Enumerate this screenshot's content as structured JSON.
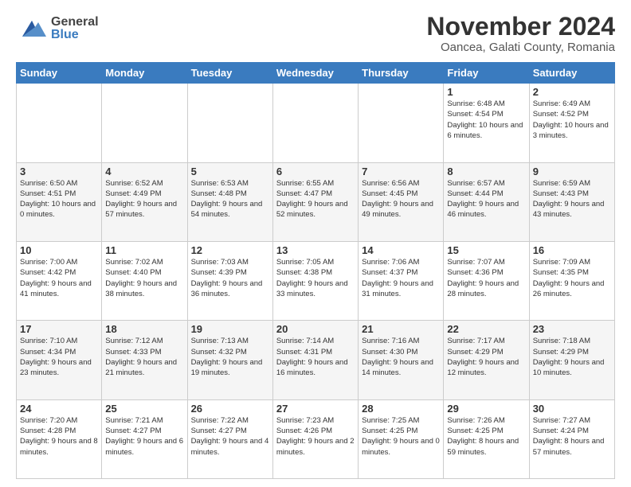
{
  "header": {
    "title": "November 2024",
    "subtitle": "Oancea, Galati County, Romania"
  },
  "logo": {
    "general": "General",
    "blue": "Blue"
  },
  "weekdays": [
    "Sunday",
    "Monday",
    "Tuesday",
    "Wednesday",
    "Thursday",
    "Friday",
    "Saturday"
  ],
  "weeks": [
    [
      {
        "day": "",
        "info": ""
      },
      {
        "day": "",
        "info": ""
      },
      {
        "day": "",
        "info": ""
      },
      {
        "day": "",
        "info": ""
      },
      {
        "day": "",
        "info": ""
      },
      {
        "day": "1",
        "info": "Sunrise: 6:48 AM\nSunset: 4:54 PM\nDaylight: 10 hours and 6 minutes."
      },
      {
        "day": "2",
        "info": "Sunrise: 6:49 AM\nSunset: 4:52 PM\nDaylight: 10 hours and 3 minutes."
      }
    ],
    [
      {
        "day": "3",
        "info": "Sunrise: 6:50 AM\nSunset: 4:51 PM\nDaylight: 10 hours and 0 minutes."
      },
      {
        "day": "4",
        "info": "Sunrise: 6:52 AM\nSunset: 4:49 PM\nDaylight: 9 hours and 57 minutes."
      },
      {
        "day": "5",
        "info": "Sunrise: 6:53 AM\nSunset: 4:48 PM\nDaylight: 9 hours and 54 minutes."
      },
      {
        "day": "6",
        "info": "Sunrise: 6:55 AM\nSunset: 4:47 PM\nDaylight: 9 hours and 52 minutes."
      },
      {
        "day": "7",
        "info": "Sunrise: 6:56 AM\nSunset: 4:45 PM\nDaylight: 9 hours and 49 minutes."
      },
      {
        "day": "8",
        "info": "Sunrise: 6:57 AM\nSunset: 4:44 PM\nDaylight: 9 hours and 46 minutes."
      },
      {
        "day": "9",
        "info": "Sunrise: 6:59 AM\nSunset: 4:43 PM\nDaylight: 9 hours and 43 minutes."
      }
    ],
    [
      {
        "day": "10",
        "info": "Sunrise: 7:00 AM\nSunset: 4:42 PM\nDaylight: 9 hours and 41 minutes."
      },
      {
        "day": "11",
        "info": "Sunrise: 7:02 AM\nSunset: 4:40 PM\nDaylight: 9 hours and 38 minutes."
      },
      {
        "day": "12",
        "info": "Sunrise: 7:03 AM\nSunset: 4:39 PM\nDaylight: 9 hours and 36 minutes."
      },
      {
        "day": "13",
        "info": "Sunrise: 7:05 AM\nSunset: 4:38 PM\nDaylight: 9 hours and 33 minutes."
      },
      {
        "day": "14",
        "info": "Sunrise: 7:06 AM\nSunset: 4:37 PM\nDaylight: 9 hours and 31 minutes."
      },
      {
        "day": "15",
        "info": "Sunrise: 7:07 AM\nSunset: 4:36 PM\nDaylight: 9 hours and 28 minutes."
      },
      {
        "day": "16",
        "info": "Sunrise: 7:09 AM\nSunset: 4:35 PM\nDaylight: 9 hours and 26 minutes."
      }
    ],
    [
      {
        "day": "17",
        "info": "Sunrise: 7:10 AM\nSunset: 4:34 PM\nDaylight: 9 hours and 23 minutes."
      },
      {
        "day": "18",
        "info": "Sunrise: 7:12 AM\nSunset: 4:33 PM\nDaylight: 9 hours and 21 minutes."
      },
      {
        "day": "19",
        "info": "Sunrise: 7:13 AM\nSunset: 4:32 PM\nDaylight: 9 hours and 19 minutes."
      },
      {
        "day": "20",
        "info": "Sunrise: 7:14 AM\nSunset: 4:31 PM\nDaylight: 9 hours and 16 minutes."
      },
      {
        "day": "21",
        "info": "Sunrise: 7:16 AM\nSunset: 4:30 PM\nDaylight: 9 hours and 14 minutes."
      },
      {
        "day": "22",
        "info": "Sunrise: 7:17 AM\nSunset: 4:29 PM\nDaylight: 9 hours and 12 minutes."
      },
      {
        "day": "23",
        "info": "Sunrise: 7:18 AM\nSunset: 4:29 PM\nDaylight: 9 hours and 10 minutes."
      }
    ],
    [
      {
        "day": "24",
        "info": "Sunrise: 7:20 AM\nSunset: 4:28 PM\nDaylight: 9 hours and 8 minutes."
      },
      {
        "day": "25",
        "info": "Sunrise: 7:21 AM\nSunset: 4:27 PM\nDaylight: 9 hours and 6 minutes."
      },
      {
        "day": "26",
        "info": "Sunrise: 7:22 AM\nSunset: 4:27 PM\nDaylight: 9 hours and 4 minutes."
      },
      {
        "day": "27",
        "info": "Sunrise: 7:23 AM\nSunset: 4:26 PM\nDaylight: 9 hours and 2 minutes."
      },
      {
        "day": "28",
        "info": "Sunrise: 7:25 AM\nSunset: 4:25 PM\nDaylight: 9 hours and 0 minutes."
      },
      {
        "day": "29",
        "info": "Sunrise: 7:26 AM\nSunset: 4:25 PM\nDaylight: 8 hours and 59 minutes."
      },
      {
        "day": "30",
        "info": "Sunrise: 7:27 AM\nSunset: 4:24 PM\nDaylight: 8 hours and 57 minutes."
      }
    ]
  ]
}
